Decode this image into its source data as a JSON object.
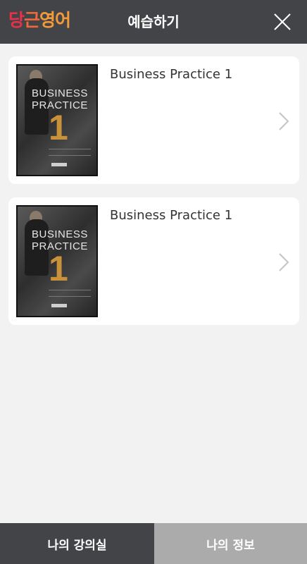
{
  "header": {
    "logo": {
      "part1": "당",
      "part2": "근",
      "part3": "영어"
    },
    "title": "예습하기",
    "close_icon": "close-icon"
  },
  "items": [
    {
      "title": "Business Practice 1",
      "cover": {
        "line1": "BUSINESS",
        "line2": "PRACTICE",
        "number": "1"
      }
    },
    {
      "title": "Business Practice 1",
      "cover": {
        "line1": "BUSINESS",
        "line2": "PRACTICE",
        "number": "1"
      }
    }
  ],
  "tabs": [
    {
      "label": "나의 강의실"
    },
    {
      "label": "나의 정보"
    }
  ],
  "colors": {
    "header_bg": "#434448",
    "brand_red": "#e8304a",
    "brand_orange": "#f29a3a",
    "active_tab_bg": "#434448",
    "inactive_tab_bg": "#ababab",
    "page_bg": "#f2f2f2"
  }
}
